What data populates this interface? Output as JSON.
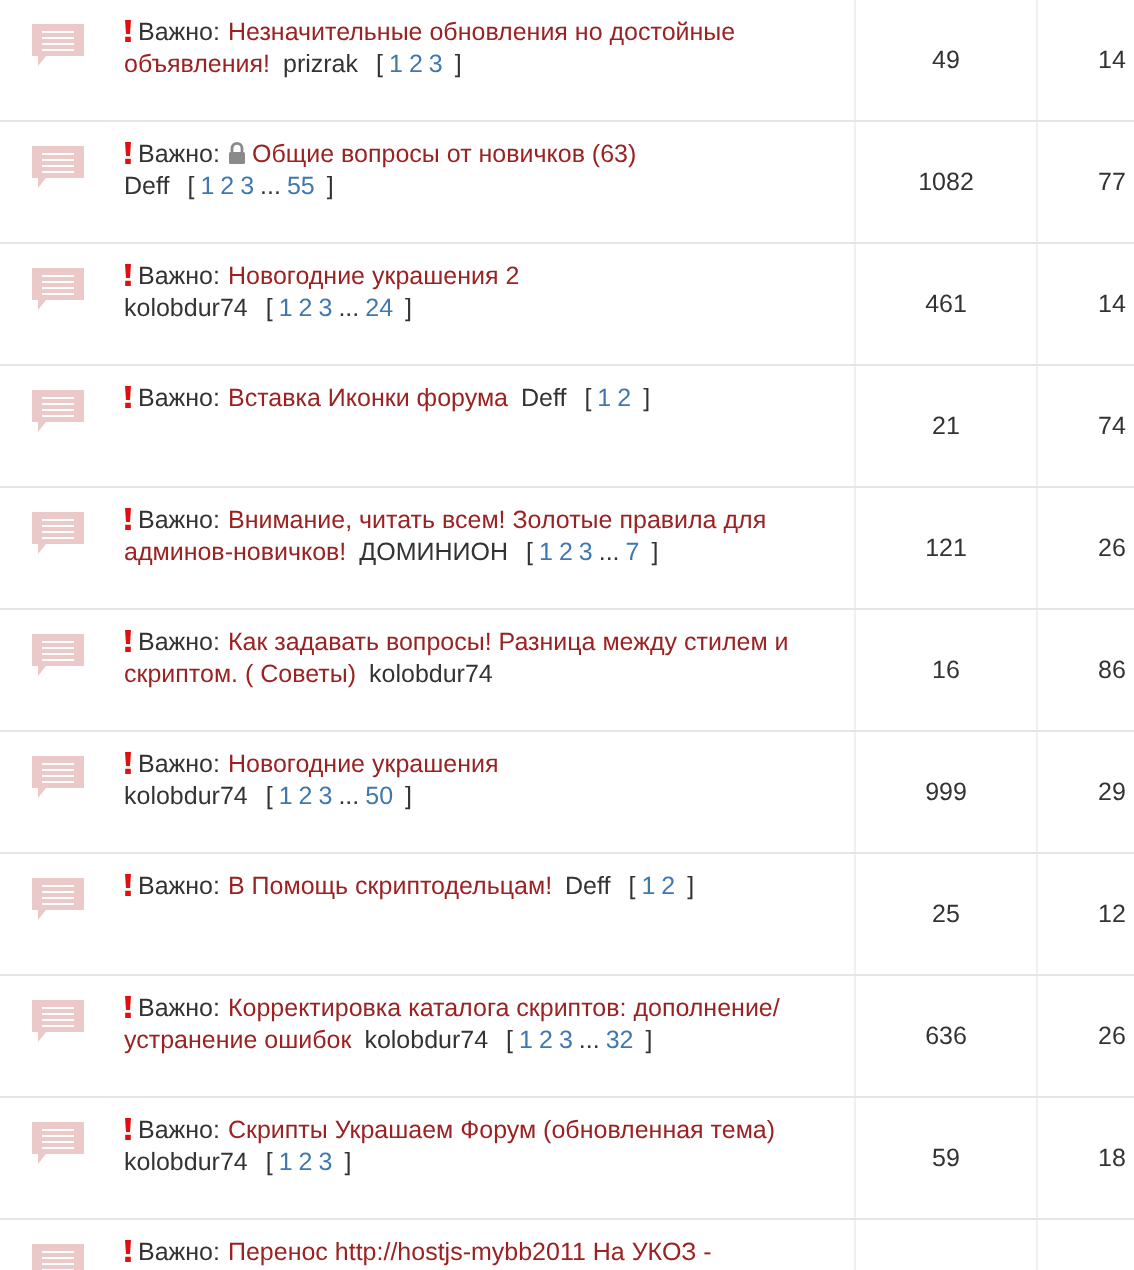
{
  "topics": [
    {
      "important": "Важно:",
      "locked": false,
      "title": [
        "Незначительные обновления но достойные",
        "объявления!"
      ],
      "author": "prizrak",
      "pages": [
        {
          "kind": "bracket",
          "text": "["
        },
        {
          "kind": "link",
          "text": "1"
        },
        {
          "kind": "link",
          "text": "2"
        },
        {
          "kind": "link",
          "text": "3"
        },
        {
          "kind": "bracket",
          "text": "]"
        }
      ],
      "replies": "49",
      "views": "14"
    },
    {
      "important": "Важно:",
      "locked": true,
      "title": [
        "Общие вопросы от новичков (63)"
      ],
      "author": "Deff",
      "pages": [
        {
          "kind": "bracket",
          "text": "["
        },
        {
          "kind": "link",
          "text": "1"
        },
        {
          "kind": "link",
          "text": "2"
        },
        {
          "kind": "link",
          "text": "3"
        },
        {
          "kind": "gap",
          "text": "..."
        },
        {
          "kind": "link",
          "text": "55"
        },
        {
          "kind": "bracket",
          "text": "]"
        }
      ],
      "replies": "1082",
      "views": "77"
    },
    {
      "important": "Важно:",
      "locked": false,
      "title": [
        "Новогодние украшения 2"
      ],
      "author": "kolobdur74",
      "pages": [
        {
          "kind": "bracket",
          "text": "["
        },
        {
          "kind": "link",
          "text": "1"
        },
        {
          "kind": "link",
          "text": "2"
        },
        {
          "kind": "link",
          "text": "3"
        },
        {
          "kind": "gap",
          "text": "..."
        },
        {
          "kind": "link",
          "text": "24"
        },
        {
          "kind": "bracket",
          "text": "]"
        }
      ],
      "replies": "461",
      "views": "14"
    },
    {
      "important": "Важно:",
      "locked": false,
      "title": [
        "Вставка Иконки форума"
      ],
      "author": "Deff",
      "pages": [
        {
          "kind": "bracket",
          "text": "["
        },
        {
          "kind": "link",
          "text": "1"
        },
        {
          "kind": "link",
          "text": "2"
        },
        {
          "kind": "bracket",
          "text": "]"
        }
      ],
      "replies": "21",
      "views": "74"
    },
    {
      "important": "Важно:",
      "locked": false,
      "title": [
        "Внимание, читать всем! Золотые правила для",
        "админов-новичков!"
      ],
      "author": "ДОМИНИОН",
      "pages": [
        {
          "kind": "bracket",
          "text": "["
        },
        {
          "kind": "link",
          "text": "1"
        },
        {
          "kind": "link",
          "text": "2"
        },
        {
          "kind": "link",
          "text": "3"
        },
        {
          "kind": "gap",
          "text": "..."
        },
        {
          "kind": "link",
          "text": "7"
        },
        {
          "kind": "bracket",
          "text": "]"
        }
      ],
      "replies": "121",
      "views": "26"
    },
    {
      "important": "Важно:",
      "locked": false,
      "title": [
        "Как задавать вопросы! Разница между стилем и",
        "скриптом. ( Советы)"
      ],
      "author": "kolobdur74",
      "replies": "16",
      "views": "86"
    },
    {
      "important": "Важно:",
      "locked": false,
      "title": [
        "Новогодние украшения"
      ],
      "author": "kolobdur74",
      "pages": [
        {
          "kind": "bracket",
          "text": "["
        },
        {
          "kind": "link",
          "text": "1"
        },
        {
          "kind": "link",
          "text": "2"
        },
        {
          "kind": "link",
          "text": "3"
        },
        {
          "kind": "gap",
          "text": "..."
        },
        {
          "kind": "link",
          "text": "50"
        },
        {
          "kind": "bracket",
          "text": "]"
        }
      ],
      "replies": "999",
      "views": "29"
    },
    {
      "important": "Важно:",
      "locked": false,
      "title": [
        "В Помощь скриптодельцам!"
      ],
      "author": "Deff",
      "pages": [
        {
          "kind": "bracket",
          "text": "["
        },
        {
          "kind": "link",
          "text": "1"
        },
        {
          "kind": "link",
          "text": "2"
        },
        {
          "kind": "bracket",
          "text": "]"
        }
      ],
      "replies": "25",
      "views": "12"
    },
    {
      "important": "Важно:",
      "locked": false,
      "title": [
        "Корректировка каталога скриптов: дополнение/",
        "устранение ошибок"
      ],
      "author": "kolobdur74",
      "pages": [
        {
          "kind": "bracket",
          "text": "["
        },
        {
          "kind": "link",
          "text": "1"
        },
        {
          "kind": "link",
          "text": "2"
        },
        {
          "kind": "link",
          "text": "3"
        },
        {
          "kind": "gap",
          "text": "..."
        },
        {
          "kind": "link",
          "text": "32"
        },
        {
          "kind": "bracket",
          "text": "]"
        }
      ],
      "replies": "636",
      "views": "26"
    },
    {
      "important": "Важно:",
      "locked": false,
      "title": [
        "Скрипты Украшаем Форум (обновленная тема)"
      ],
      "author": "kolobdur74",
      "pages": [
        {
          "kind": "bracket",
          "text": "["
        },
        {
          "kind": "link",
          "text": "1"
        },
        {
          "kind": "link",
          "text": "2"
        },
        {
          "kind": "link",
          "text": "3"
        },
        {
          "kind": "bracket",
          "text": "]"
        }
      ],
      "replies": "59",
      "views": "18"
    },
    {
      "important": "Важно:",
      "locked": false,
      "title": [
        "Перенос http://hostjs-mybb2011 На УКОЗ -"
      ]
    }
  ]
}
